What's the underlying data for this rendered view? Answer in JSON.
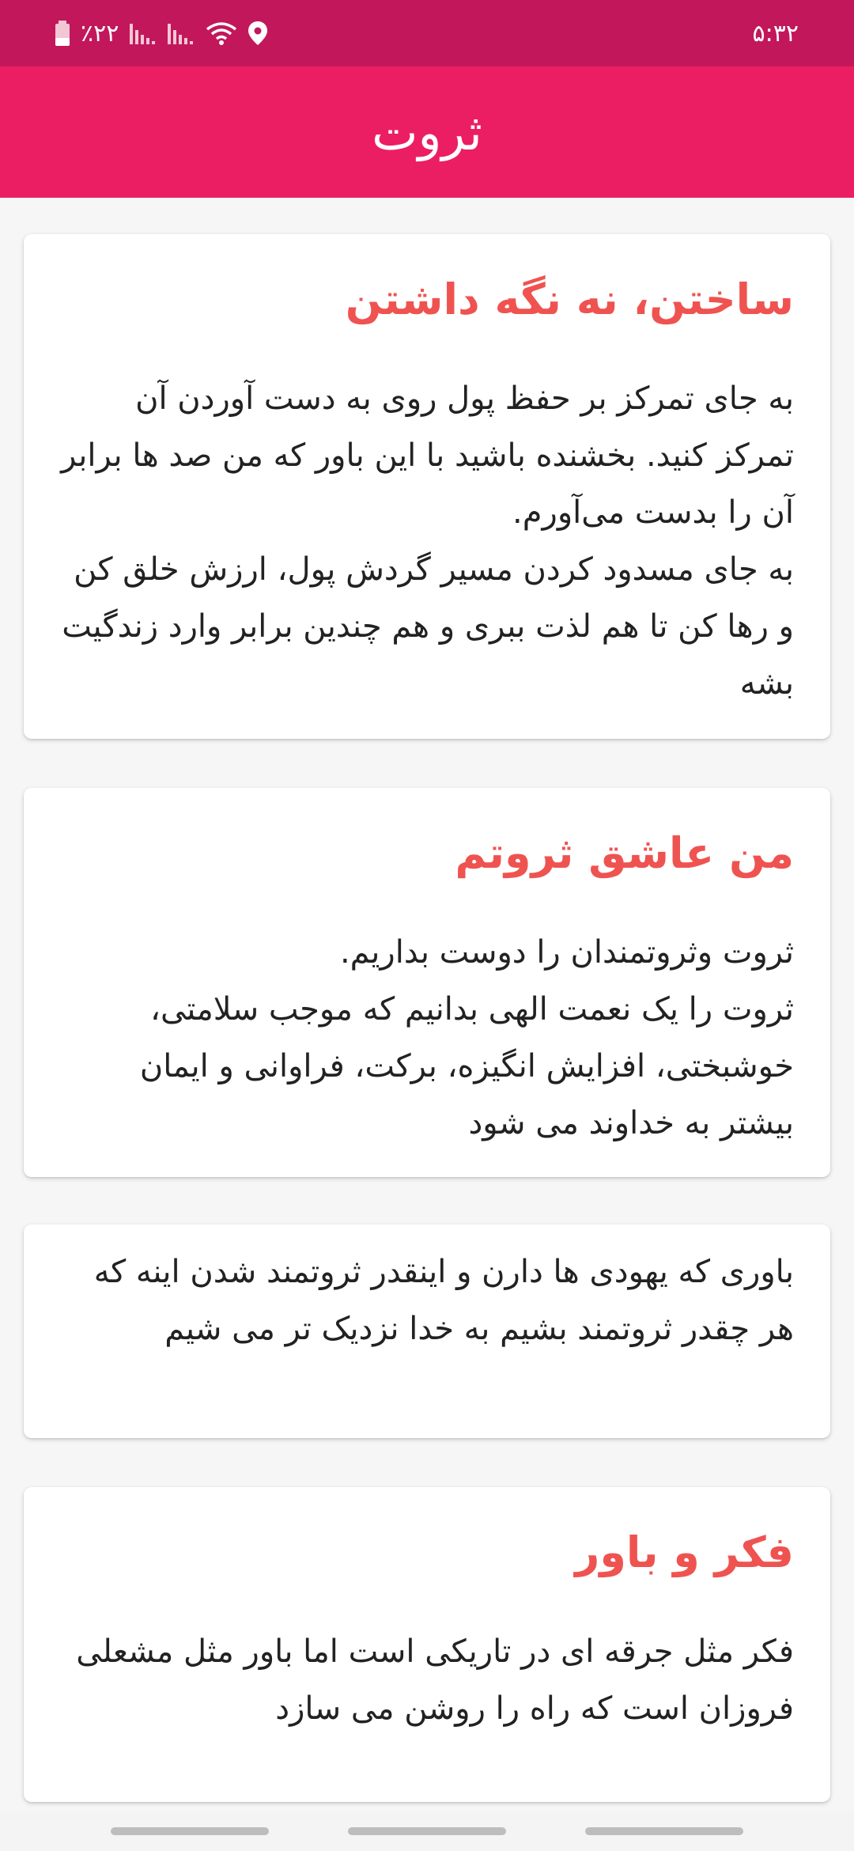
{
  "status_bar": {
    "time": "۵:۳۲",
    "battery": "٪۲۲",
    "icons": [
      "battery-icon",
      "signal-icon",
      "signal-icon",
      "wifi-icon",
      "location-icon"
    ]
  },
  "app_bar": {
    "title": "ثروت"
  },
  "cards": [
    {
      "title": "ساختن، نه نگه داشتن",
      "body": "به جای تمرکز بر حفظ پول روی به دست آوردن آن تمرکز کنید. بخشنده باشید با این باور که من صد ها برابر آن را بدست می‌آورم.\nبه جای مسدود کردن مسیر گردش پول، ارزش خلق کن و رها کن تا هم لذت ببری و هم چندین برابر وارد زندگیت بشه"
    },
    {
      "title": "من عاشق ثروتم",
      "body": "ثروت وثروتمندان را دوست بداریم.\nثروت را یک نعمت الهی بدانیم که موجب سلامتی، خوشبختی، افزایش انگیزه، برکت، فراوانی و ایمان بیشتر به خداوند می شود"
    },
    {
      "body": "باوری که یهودی ها دارن و اینقدر ثروتمند شدن اینه که هر چقدر ثروتمند بشیم به خدا نزدیک تر می شیم"
    },
    {
      "title": "فکر و باور",
      "body": "فکر مثل جرقه ای در تاریکی است اما باور مثل مشعلی فروزان است که راه را روشن می سازد"
    }
  ],
  "colors": {
    "status_bar": "#c2185b",
    "app_bar": "#ec1e63",
    "card_title": "#ef5350",
    "background": "#f6f6f6"
  }
}
